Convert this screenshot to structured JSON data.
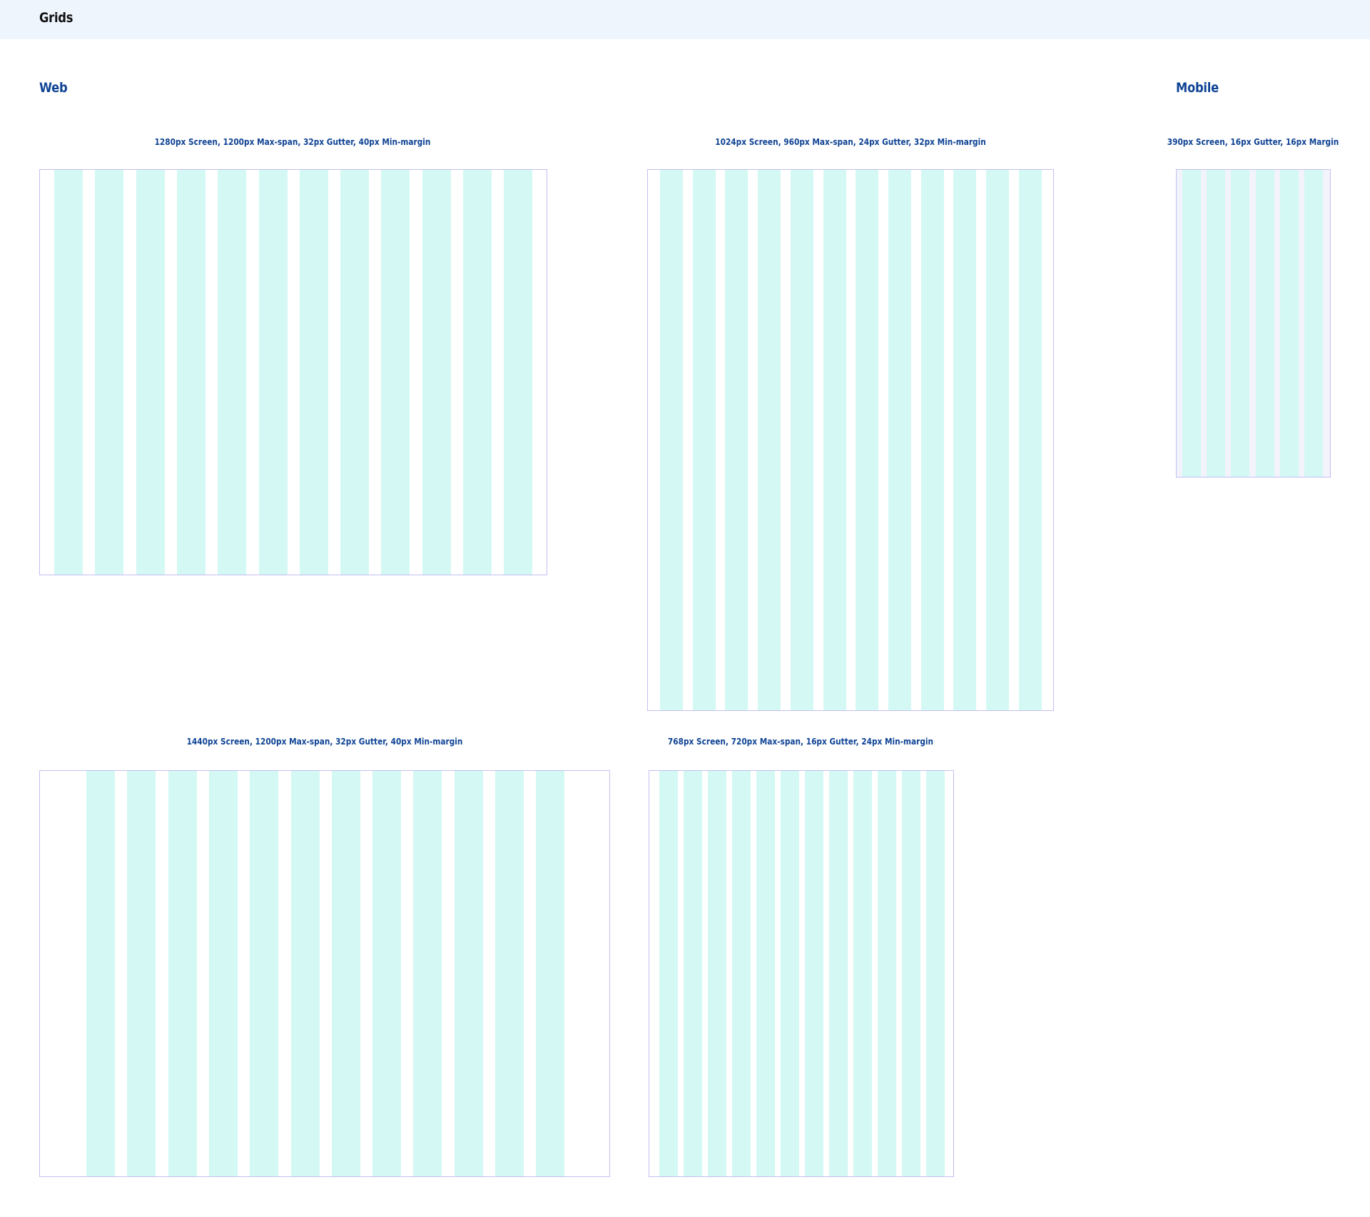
{
  "header": {
    "title": "Grids"
  },
  "sections": {
    "web": "Web",
    "mobile": "Mobile"
  },
  "colors": {
    "header_background": "#eef5fd",
    "heading_text": "#0f4394",
    "column_fill": "#d4f8f3",
    "frame_border": "#c3bff4"
  },
  "grids": {
    "web_1280": {
      "caption": "1280px Screen, 1200px Max-span, 32px Gutter, 40px Min-margin",
      "columns": 12
    },
    "web_1024": {
      "caption": "1024px Screen, 960px Max-span, 24px Gutter, 32px Min-margin",
      "columns": 12
    },
    "mobile_390": {
      "caption": "390px Screen, 16px Gutter, 16px Margin",
      "columns": 6
    },
    "web_1440": {
      "caption": "1440px Screen, 1200px Max-span, 32px Gutter, 40px Min-margin",
      "columns": 12
    },
    "web_768": {
      "caption": "768px Screen, 720px Max-span, 16px Gutter, 24px Min-margin",
      "columns": 12
    }
  }
}
